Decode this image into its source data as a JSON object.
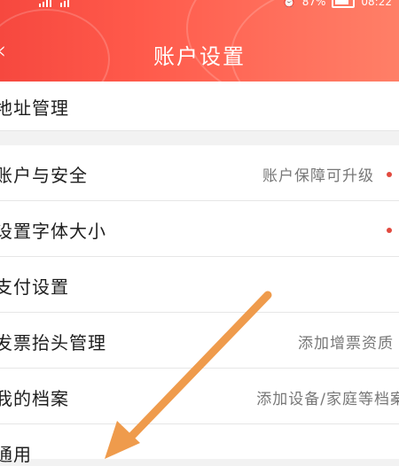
{
  "status_bar": {
    "signal_label": "",
    "battery": "87%",
    "time": "08:22"
  },
  "nav": {
    "title": "账户设置",
    "back_icon": "chevron-left-icon"
  },
  "section1": {
    "items": [
      {
        "label": "地址管理",
        "value": ""
      }
    ]
  },
  "section2": {
    "items": [
      {
        "label": "账户与安全",
        "value": "账户保障可升级"
      },
      {
        "label": "设置字体大小",
        "value": ""
      },
      {
        "label": "支付设置",
        "value": ""
      },
      {
        "label": "发票抬头管理",
        "value": "添加增票资质"
      },
      {
        "label": "我的档案",
        "value": "添加设备/家庭等档案"
      },
      {
        "label": "通用",
        "value": ""
      }
    ]
  },
  "colors": {
    "header": "#f6483f",
    "dot": "#e24a3f",
    "arrow": "#ef9b4c"
  }
}
